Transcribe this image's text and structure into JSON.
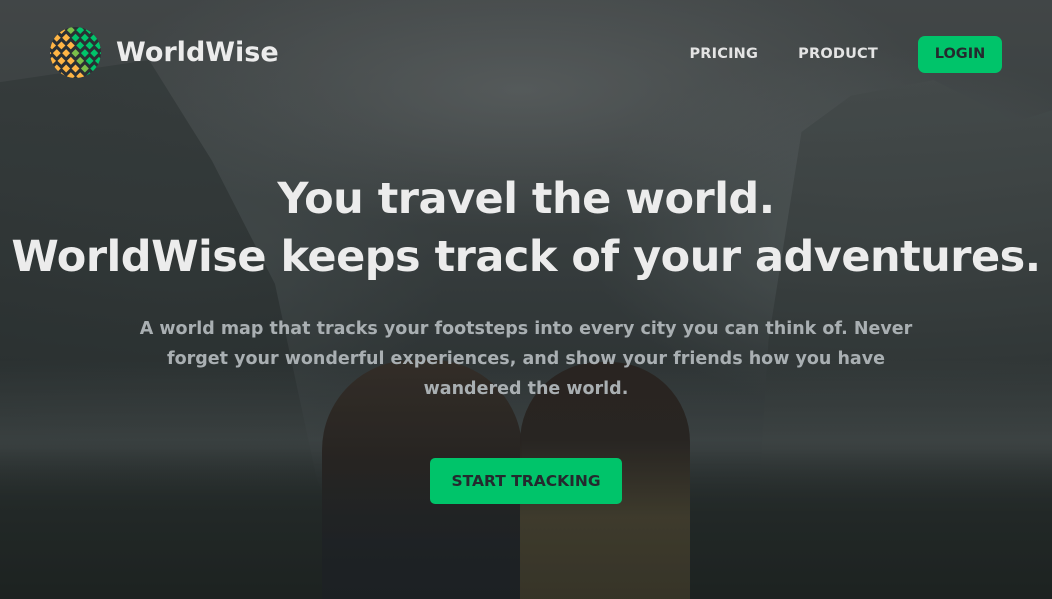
{
  "brand": {
    "name": "WorldWise",
    "logo_icon": "globe-grid-icon"
  },
  "nav": {
    "items": [
      {
        "label": "PRICING"
      },
      {
        "label": "PRODUCT"
      }
    ],
    "login_label": "LOGIN"
  },
  "hero": {
    "title_line1": "You travel the world.",
    "title_line2": "WorldWise keeps track of your adventures.",
    "subtitle": "A world map that tracks your footsteps into every city you can think of. Never forget your wonderful experiences, and show your friends how you have wandered the world.",
    "cta_label": "START TRACKING"
  },
  "colors": {
    "accent": "#00c46a",
    "logo_orange": "#ffb545",
    "logo_green": "#00c46a",
    "text_light": "#ececec",
    "text_muted": "#a9afb2",
    "button_text": "#242a2e"
  }
}
